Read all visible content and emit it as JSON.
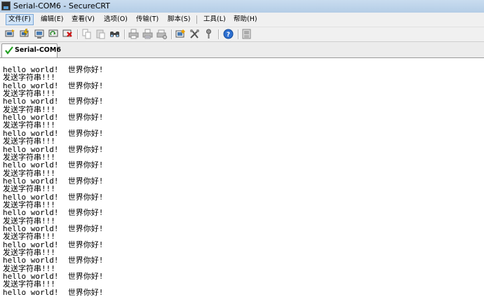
{
  "window": {
    "title": "Serial-COM6 - SecureCRT"
  },
  "menu": [
    "文件(F)",
    "编辑(E)",
    "查看(V)",
    "选项(O)",
    "传输(T)",
    "脚本(S)",
    "工具(L)",
    "帮助(H)"
  ],
  "toolbar": {
    "icons": [
      "connect-icon",
      "quick-connect-icon",
      "connect-tab-icon",
      "reconnect-icon",
      "disconnect-icon",
      "copy-icon",
      "paste-icon",
      "find-icon",
      "print-icon",
      "print-selection-icon",
      "print-setup-icon",
      "session-options-icon",
      "global-options-icon",
      "keymap-icon",
      "help-icon",
      "about-icon"
    ]
  },
  "tab": {
    "label": "Serial-COM6"
  },
  "terminal": {
    "lines": [
      "hello world!  世界你好!",
      "发送字符串!!!",
      "hello world!  世界你好!",
      "发送字符串!!!",
      "hello world!  世界你好!",
      "发送字符串!!!",
      "hello world!  世界你好!",
      "发送字符串!!!",
      "hello world!  世界你好!",
      "发送字符串!!!",
      "hello world!  世界你好!",
      "发送字符串!!!",
      "hello world!  世界你好!",
      "发送字符串!!!",
      "hello world!  世界你好!",
      "发送字符串!!!",
      "hello world!  世界你好!",
      "发送字符串!!!",
      "hello world!  世界你好!",
      "发送字符串!!!",
      "hello world!  世界你好!",
      "发送字符串!!!",
      "hello world!  世界你好!",
      "发送字符串!!!",
      "hello world!  世界你好!",
      "发送字符串!!!",
      "hello world!  世界你好!",
      "发送字符串!!!",
      "hello world!  世界你好!"
    ]
  }
}
